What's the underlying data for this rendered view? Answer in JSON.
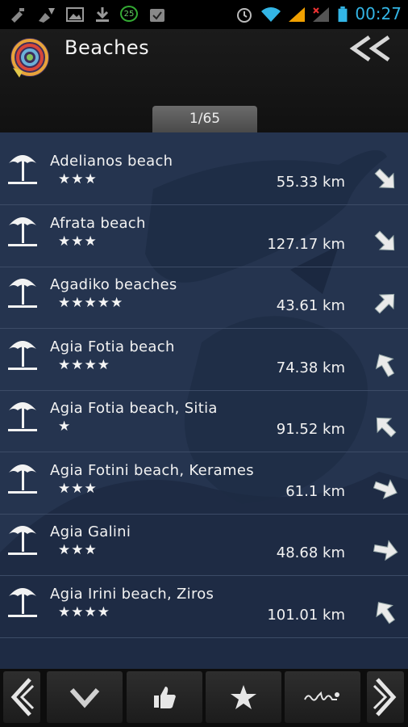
{
  "status_bar": {
    "time": "00:27",
    "notification_badge": "25",
    "time_color": "#33b5e5"
  },
  "header": {
    "title": "Beaches",
    "counter": "1/65"
  },
  "beaches": [
    {
      "name": "Adelianos beach",
      "stars": "★★★",
      "distance": "55.33 km",
      "direction_deg": 135
    },
    {
      "name": "Afrata beach",
      "stars": "★★★",
      "distance": "127.17 km",
      "direction_deg": 135
    },
    {
      "name": "Agadiko beaches",
      "stars": "★★★★★",
      "distance": "43.61 km",
      "direction_deg": 45
    },
    {
      "name": "Agia Fotia beach",
      "stars": "★★★★",
      "distance": "74.38 km",
      "direction_deg": -30
    },
    {
      "name": "Agia Fotia beach, Sitia",
      "stars": "★",
      "distance": "91.52 km",
      "direction_deg": -45
    },
    {
      "name": "Agia Fotini beach, Kerames",
      "stars": "★★★",
      "distance": "61.1 km",
      "direction_deg": 110
    },
    {
      "name": "Agia Galini",
      "stars": "★★★",
      "distance": "48.68 km",
      "direction_deg": 100
    },
    {
      "name": "Agia Irini beach, Ziros",
      "stars": "★★★★",
      "distance": "101.01 km",
      "direction_deg": -35
    }
  ],
  "toolbar": {
    "buttons": [
      "previous",
      "more",
      "like",
      "favorite",
      "route",
      "next"
    ]
  },
  "colors": {
    "list_bg": "#25344f",
    "header_bg": "#1b1b1b",
    "accent": "#33b5e5"
  }
}
